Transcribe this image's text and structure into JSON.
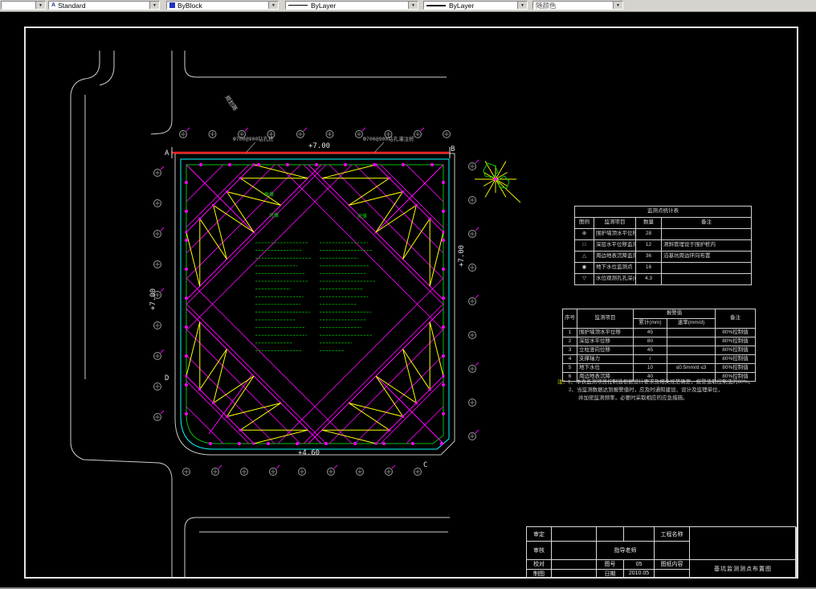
{
  "toolbar": {
    "combo0": {
      "value": ""
    },
    "style_combo": {
      "value": "Standard",
      "icon": "A"
    },
    "color_combo": {
      "value": "ByBlock"
    },
    "linetype_combo": {
      "value": "ByLayer"
    },
    "lineweight_combo": {
      "value": "ByLayer"
    },
    "plotstyle_combo": {
      "value": "随颜色"
    }
  },
  "drawing": {
    "corner_a": "A",
    "corner_b": "B",
    "corner_c": "C",
    "corner_d": "D",
    "elev_top": "+7.00",
    "elev_right": "+7.00",
    "elev_left": "+7.00",
    "elev_bottom": "+4.60",
    "pile_label_left": "Ф700@900钻孔桩",
    "pile_label_right": "Ф700@900钻孔灌注桩",
    "road_label": "规划路",
    "strut_labels": [
      "角撑",
      "对撑",
      "对撑"
    ]
  },
  "stats_table": {
    "title": "监测点统计表",
    "headers": [
      "图例",
      "监测项目",
      "数量",
      "备注"
    ],
    "rows": [
      {
        "glyph": "⊕",
        "name": "围护墙顶水平位移监测点",
        "count": "28",
        "note": ""
      },
      {
        "glyph": "□",
        "name": "深层水平位移监测点",
        "count": "12",
        "note": "测斜管埋设于围护桩内"
      },
      {
        "glyph": "△",
        "name": "周边地表沉降监测点",
        "count": "36",
        "note": "沿基坑周边环向布置"
      },
      {
        "glyph": "◉",
        "name": "地下水位监测点",
        "count": "16",
        "note": ""
      },
      {
        "glyph": "▽",
        "name": "水位观测孔孔深(m)",
        "count": "4.3",
        "note": ""
      }
    ]
  },
  "alarm_table": {
    "headers": {
      "seq": "序号",
      "item": "监测项目",
      "group": "报警值",
      "sub1": "累计(mm)",
      "sub2": "速率(mm/d)",
      "note": "备注"
    },
    "rows": [
      [
        "1",
        "围护墙顶水平位移",
        "45",
        "",
        "80%控制值"
      ],
      [
        "2",
        "深层水平位移",
        "80",
        "",
        "80%控制值"
      ],
      [
        "3",
        "立柱竖向位移",
        "45",
        "",
        "80%控制值"
      ],
      [
        "4",
        "支撑轴力",
        "/",
        "",
        "80%控制值"
      ],
      [
        "5",
        "地下水位",
        "10",
        "≤0.5mm/d  ≤3",
        "80%控制值"
      ],
      [
        "6",
        "周边地表沉降",
        "40",
        "",
        "80%控制值"
      ]
    ]
  },
  "notes": {
    "label": "注：",
    "lines": [
      "1、本表监测项目控制值根据设计要求及相关规范确定，报警值取控制值的80%。",
      "2、当监测数据达到报警值时，应及时通知建设、设计及监理单位，",
      "并加密监测频率，必要时采取相应的应急措施。"
    ]
  },
  "title_block": {
    "row1_label": "审定",
    "row2_label": "审核",
    "row3_label": "校对",
    "row4_label": "制图",
    "advisor_label": "指导老师",
    "no_label": "图号",
    "no_value": "05",
    "date_label": "日期",
    "date_value": "2010.05",
    "project_label": "工程名称",
    "content_label": "图纸内容",
    "drawing_title": "基坑监测测点布置图"
  }
}
